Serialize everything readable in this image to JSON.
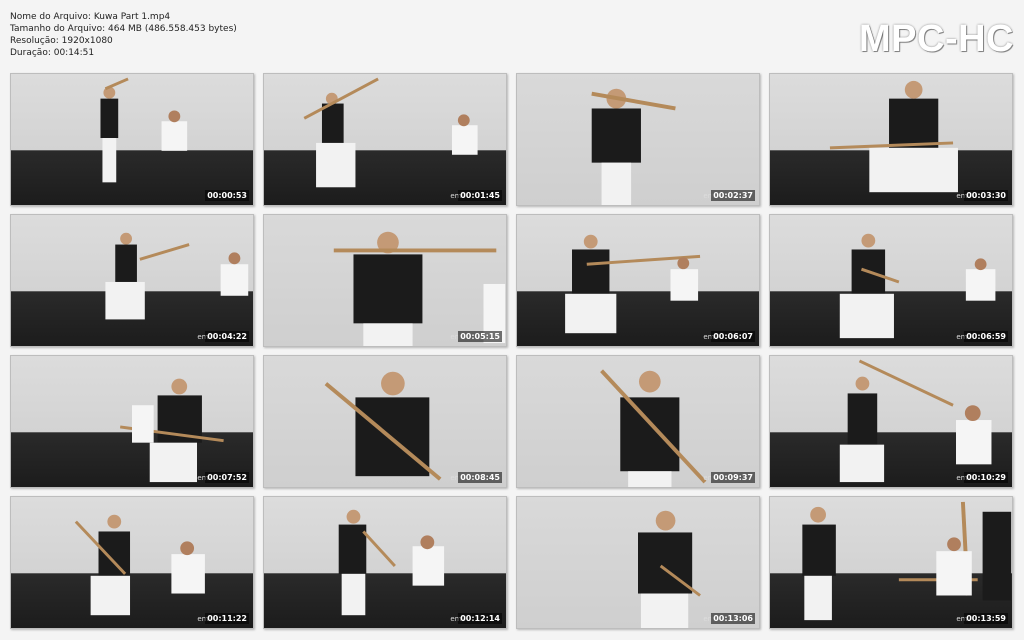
{
  "info": {
    "filename": "Nome do Arquivo: Kuwa Part 1.mp4",
    "filesize": "Tamanho do Arquivo: 464 MB (486.558.453 bytes)",
    "resolution": "Resolução: 1920x1080",
    "duration": "Duração: 00:14:51"
  },
  "logo": "MPC-HC",
  "thumbnails": [
    {
      "time": "00:00:53",
      "wm": ""
    },
    {
      "time": "00:01:45",
      "wm": "em7"
    },
    {
      "time": "00:02:37",
      "wm": "em7"
    },
    {
      "time": "00:03:30",
      "wm": "em7"
    },
    {
      "time": "00:04:22",
      "wm": "em7"
    },
    {
      "time": "00:05:15",
      "wm": "em7"
    },
    {
      "time": "00:06:07",
      "wm": "em7"
    },
    {
      "time": "00:06:59",
      "wm": "em7"
    },
    {
      "time": "00:07:52",
      "wm": "em7"
    },
    {
      "time": "00:08:45",
      "wm": "em7"
    },
    {
      "time": "00:09:37",
      "wm": "em7"
    },
    {
      "time": "00:10:29",
      "wm": "em7"
    },
    {
      "time": "00:11:22",
      "wm": "em7"
    },
    {
      "time": "00:12:14",
      "wm": "em7"
    },
    {
      "time": "00:13:06",
      "wm": "em7"
    },
    {
      "time": "00:13:59",
      "wm": "em7"
    }
  ]
}
